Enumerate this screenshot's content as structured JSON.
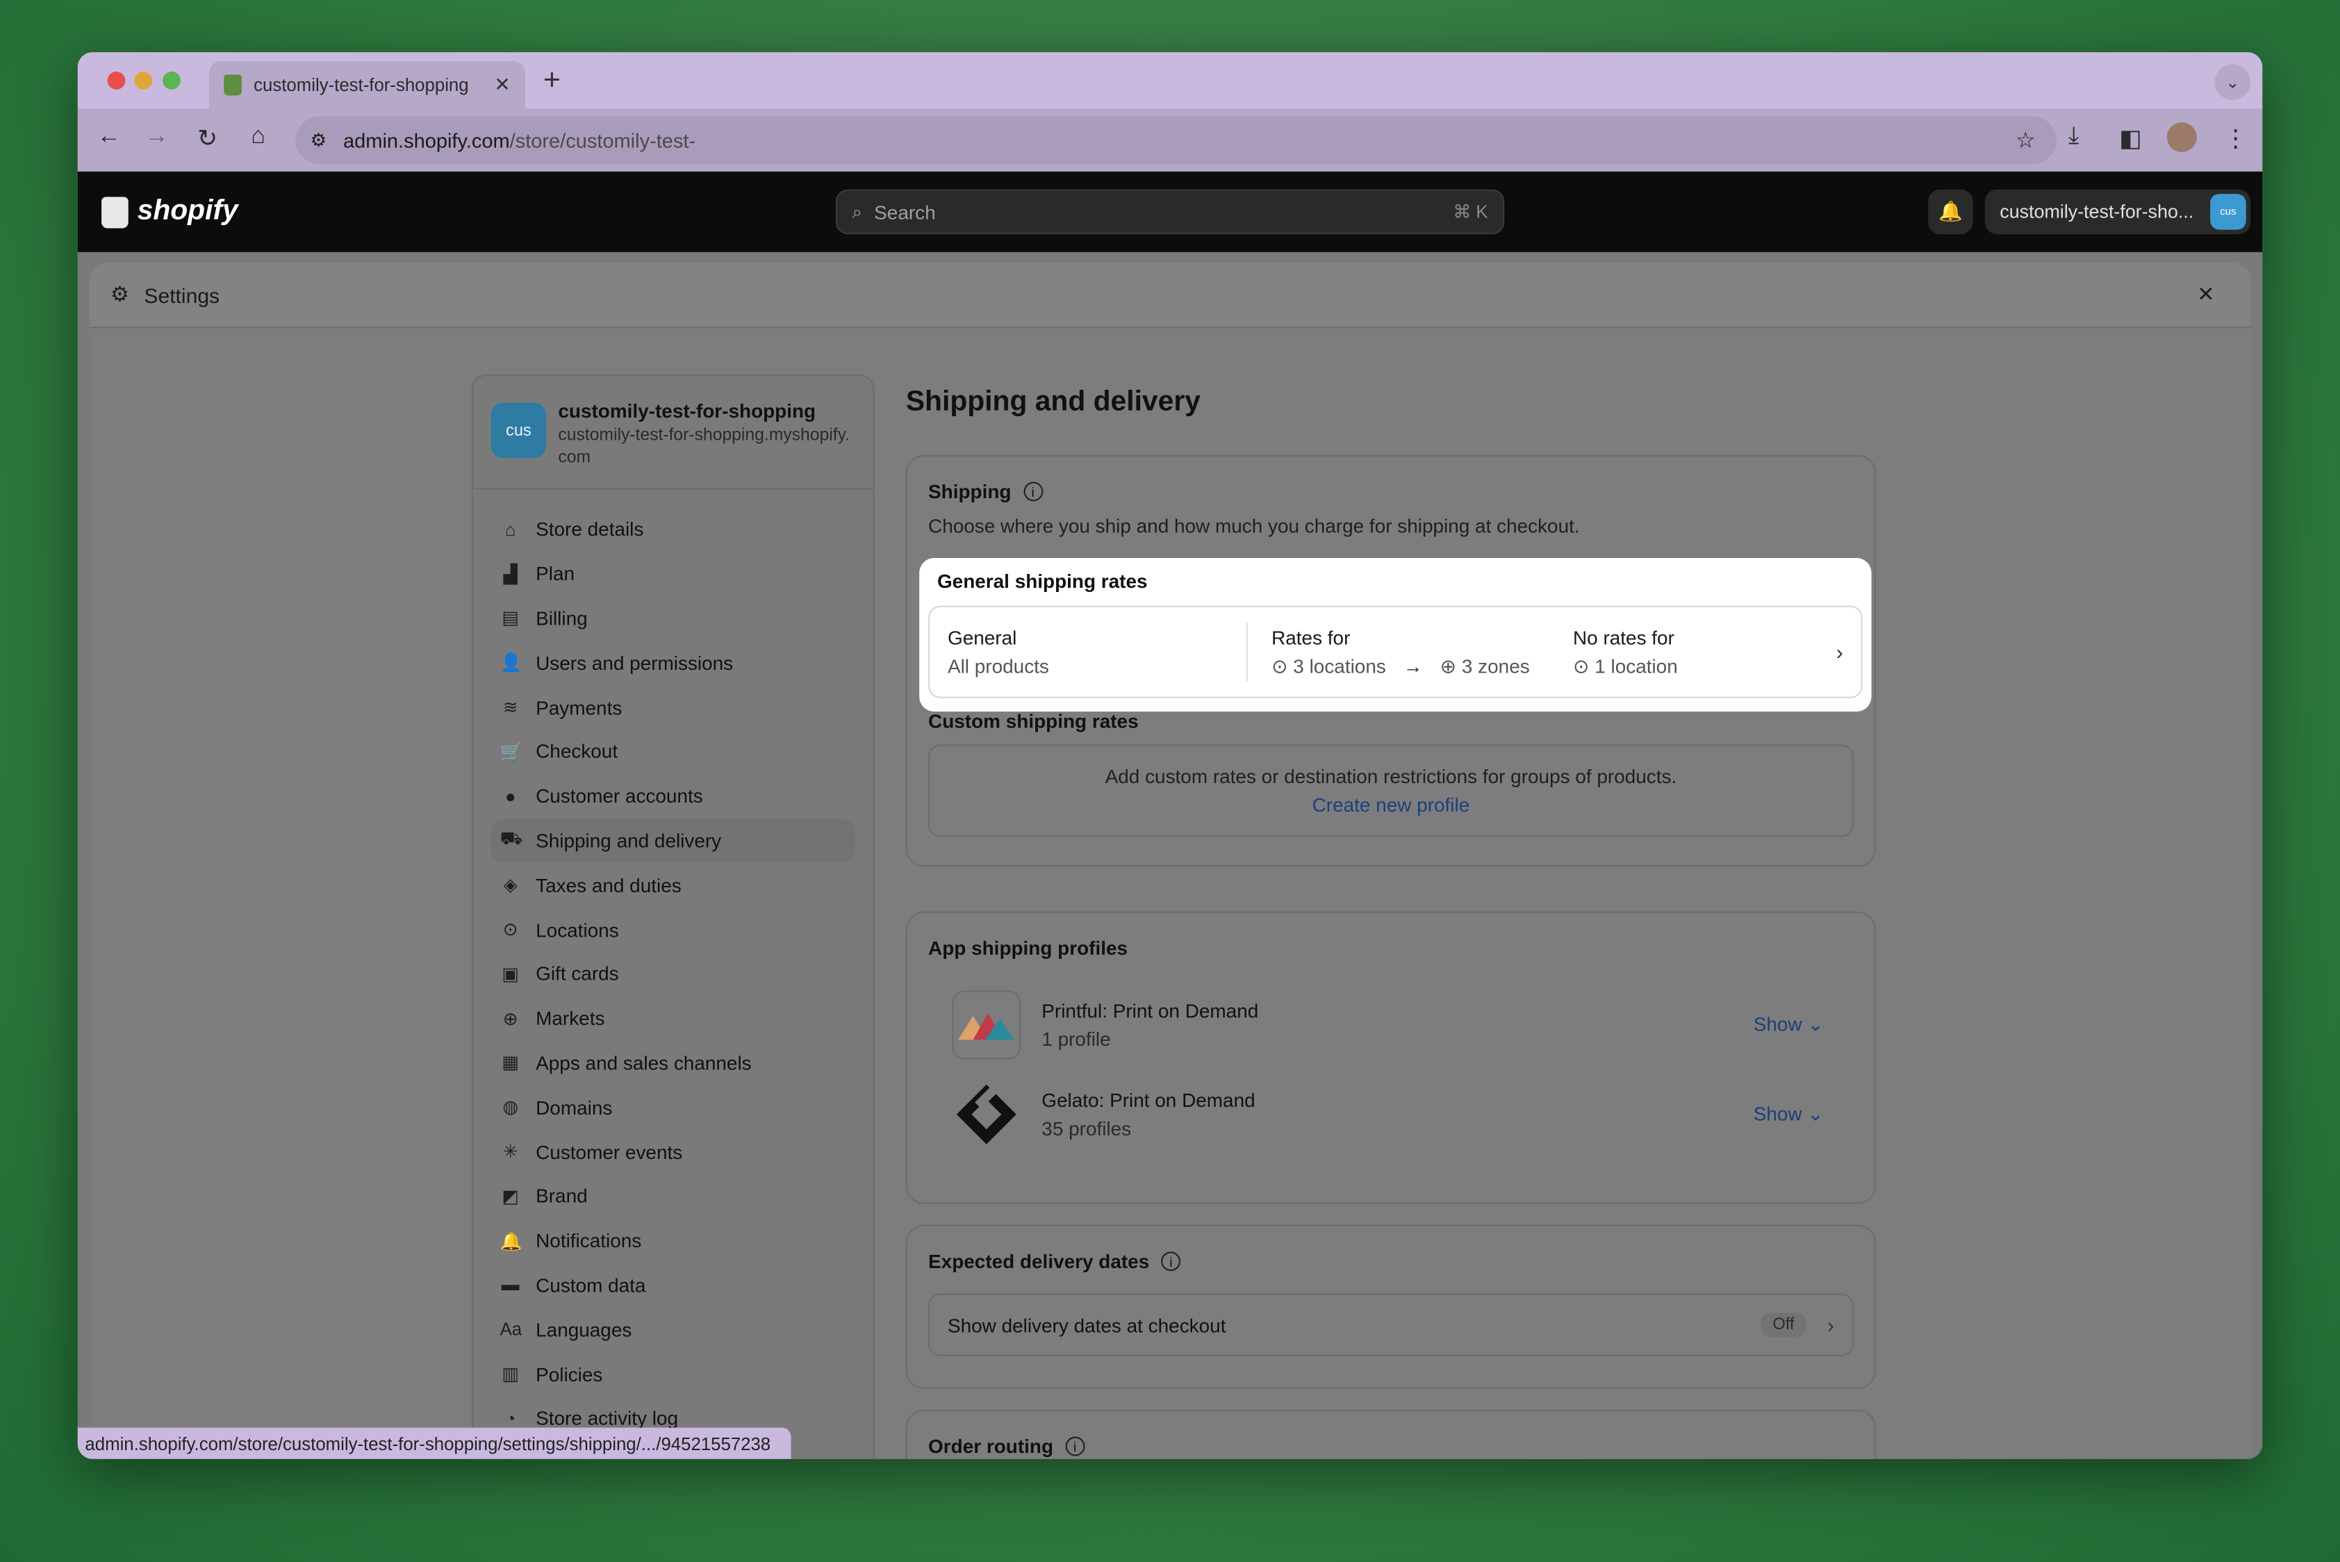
{
  "browser": {
    "tab_title": "customily-test-for-shopping",
    "new_tab": "+",
    "url_host": "admin.shopify.com",
    "url_path": "/store/customily-test-",
    "status_url": "admin.shopify.com/store/customily-test-for-shopping/settings/shipping/.../94521557238"
  },
  "topbar": {
    "logo": "shopify",
    "search_placeholder": "Search",
    "search_shortcut": "⌘ K",
    "store_button": "customily-test-for-sho...",
    "store_badge": "cus"
  },
  "settings": {
    "title": "Settings",
    "store": {
      "badge": "cus",
      "name": "customily-test-for-shopping",
      "domain": "customily-test-for-shopping.myshopify.com"
    },
    "nav": [
      {
        "label": "Store details",
        "icon": "store-icon"
      },
      {
        "label": "Plan",
        "icon": "plan-icon"
      },
      {
        "label": "Billing",
        "icon": "billing-icon"
      },
      {
        "label": "Users and permissions",
        "icon": "users-icon"
      },
      {
        "label": "Payments",
        "icon": "payments-icon"
      },
      {
        "label": "Checkout",
        "icon": "cart-icon"
      },
      {
        "label": "Customer accounts",
        "icon": "person-icon"
      },
      {
        "label": "Shipping and delivery",
        "icon": "truck-icon",
        "active": true
      },
      {
        "label": "Taxes and duties",
        "icon": "taxes-icon"
      },
      {
        "label": "Locations",
        "icon": "location-icon"
      },
      {
        "label": "Gift cards",
        "icon": "gift-card-icon"
      },
      {
        "label": "Markets",
        "icon": "globe-icon"
      },
      {
        "label": "Apps and sales channels",
        "icon": "apps-icon"
      },
      {
        "label": "Domains",
        "icon": "domains-icon"
      },
      {
        "label": "Customer events",
        "icon": "events-icon"
      },
      {
        "label": "Brand",
        "icon": "brand-icon"
      },
      {
        "label": "Notifications",
        "icon": "bell-icon"
      },
      {
        "label": "Custom data",
        "icon": "custom-data-icon"
      },
      {
        "label": "Languages",
        "icon": "languages-icon"
      },
      {
        "label": "Policies",
        "icon": "policies-icon"
      },
      {
        "label": "Store activity log",
        "icon": "activity-icon"
      }
    ]
  },
  "main": {
    "page_title": "Shipping and delivery",
    "shipping": {
      "title": "Shipping",
      "description": "Choose where you ship and how much you charge for shipping at checkout.",
      "general_label": "General shipping rates",
      "general_name": "General",
      "general_sub": "All products",
      "rates_for_label": "Rates for",
      "rates_locations": "3 locations",
      "rates_zones": "3 zones",
      "no_rates_label": "No rates for",
      "no_rates_locations": "1 location",
      "custom_label": "Custom shipping rates",
      "custom_text": "Add custom rates or destination restrictions for groups of products.",
      "custom_link": "Create new profile"
    },
    "apps": {
      "title": "App shipping profiles",
      "items": [
        {
          "name": "Printful: Print on Demand",
          "sub": "1 profile",
          "action": "Show"
        },
        {
          "name": "Gelato: Print on Demand",
          "sub": "35 profiles",
          "action": "Show"
        }
      ]
    },
    "delivery": {
      "title": "Expected delivery dates",
      "row_label": "Show delivery dates at checkout",
      "status": "Off"
    },
    "routing": {
      "title": "Order routing"
    }
  },
  "colors": {
    "highlight": "#ffffff",
    "link": "#1c3f7a",
    "store_badge": "#3d9ad1"
  }
}
